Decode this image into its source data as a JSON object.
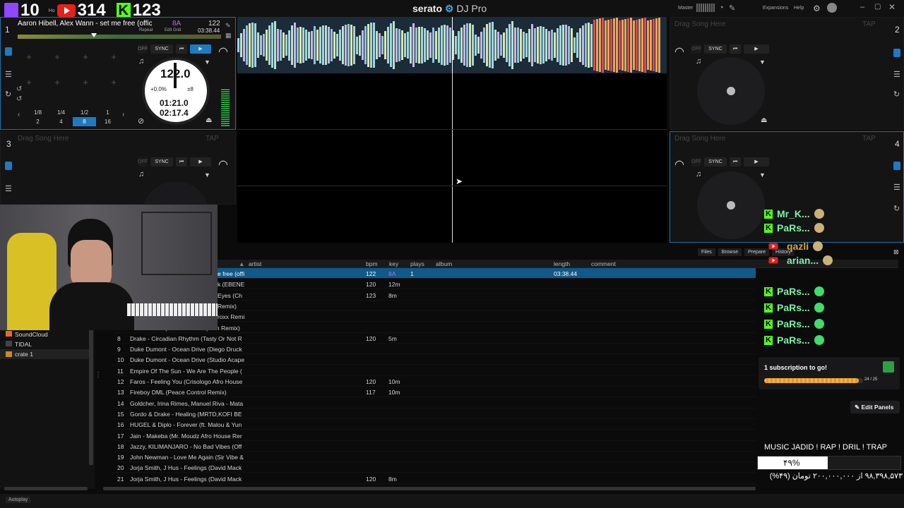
{
  "stream_counters": {
    "twitch": "10",
    "youtube": "314",
    "kick": "123",
    "home_label": "Ho"
  },
  "app": {
    "brand": "serato",
    "product": "DJ Pro",
    "master_label": "Master",
    "expansions": "Expansions",
    "help": "Help"
  },
  "deck1": {
    "number": "1",
    "title": "Aaron Hibell, Alex Wann - set me free (offic...",
    "key": "8A",
    "bpm_small": "122",
    "repeat": "Repeat",
    "edit_grid": "Edit Grid",
    "duration": "03:38.44",
    "sync": "SYNC",
    "off": "OFF",
    "platter_bpm": "122.0",
    "pitch": "+0.0%",
    "range": "±8",
    "elapsed": "01:21.0",
    "remaining": "02:17.4",
    "loops_top": [
      "1/8",
      "1/4",
      "1/2",
      "1"
    ],
    "loops_bottom": [
      "2",
      "4",
      "8",
      "16"
    ],
    "loop_selected": "8"
  },
  "deck2": {
    "number": "2",
    "drag": "Drag Song Here",
    "tap": "TAP",
    "sync": "SYNC",
    "off": "OFF"
  },
  "deck3": {
    "number": "3",
    "drag": "Drag Song Here",
    "tap": "TAP",
    "sync": "SYNC",
    "off": "OFF"
  },
  "deck4": {
    "number": "4",
    "drag": "Drag Song Here",
    "tap": "TAP",
    "sync": "SYNC",
    "off": "OFF"
  },
  "browser": {
    "tabs": [
      "Files",
      "Browse",
      "Prepare",
      "History"
    ],
    "columns": {
      "artist": "artist",
      "bpm": "bpm",
      "key": "key",
      "plays": "plays",
      "album": "album",
      "length": "length",
      "comment": "comment"
    },
    "rows": [
      {
        "n": "",
        "title": "e free (offi",
        "bpm": "122",
        "key": "8A",
        "plays": "1",
        "length": "03:38.44",
        "sel": true
      },
      {
        "n": "",
        "title": "k (EBENE",
        "bpm": "120",
        "key": "12m",
        "plays": "",
        "length": ""
      },
      {
        "n": "",
        "title": "Eyes (Ch",
        "bpm": "123",
        "key": "8m",
        "plays": "",
        "length": ""
      },
      {
        "n": "",
        "title": "Remix)",
        "bpm": "",
        "key": "",
        "plays": "",
        "length": ""
      },
      {
        "n": "",
        "title": "roxx Remi",
        "bpm": "",
        "key": "",
        "plays": "",
        "length": ""
      },
      {
        "n": "",
        "title": "Desert Rose (Afro House Rupesh Remix)",
        "bpm": "",
        "key": "",
        "plays": "",
        "length": ""
      },
      {
        "n": "8",
        "title": "Drake - Circadian Rhythm (Tasty Or Not R",
        "bpm": "120",
        "key": "5m",
        "plays": "",
        "length": ""
      },
      {
        "n": "9",
        "title": "Duke Dumont - Ocean Drive (Diego Druck",
        "bpm": "",
        "key": "",
        "plays": "",
        "length": ""
      },
      {
        "n": "10",
        "title": "Duke Dumont - Ocean Drive (Studio Acape",
        "bpm": "",
        "key": "",
        "plays": "",
        "length": ""
      },
      {
        "n": "11",
        "title": "Empire Of The Sun - We Are The People (",
        "bpm": "",
        "key": "",
        "plays": "",
        "length": ""
      },
      {
        "n": "12",
        "title": "Faros - Feeling You (Crisologo Afro House",
        "bpm": "120",
        "key": "10m",
        "plays": "",
        "length": ""
      },
      {
        "n": "13",
        "title": "Fireboy DML (Peace Control Remix)",
        "bpm": "117",
        "key": "10m",
        "plays": "",
        "length": ""
      },
      {
        "n": "14",
        "title": "Goldcher, Irina Rimes, Manuel Riva - Mata",
        "bpm": "",
        "key": "",
        "plays": "",
        "length": ""
      },
      {
        "n": "15",
        "title": "Gordo & Drake - Healing (MRTD,KOFI BE",
        "bpm": "",
        "key": "",
        "plays": "",
        "length": ""
      },
      {
        "n": "16",
        "title": "HUGEL & Diplo - Forever (ft. Malou & Yun",
        "bpm": "",
        "key": "",
        "plays": "",
        "length": ""
      },
      {
        "n": "17",
        "title": "Jain - Makeba (Mr. Moudz Afro House Rer",
        "bpm": "",
        "key": "",
        "plays": "",
        "length": ""
      },
      {
        "n": "18",
        "title": "Jazzy, KILIMANJARO - No Bad Vibes (Off",
        "bpm": "",
        "key": "",
        "plays": "",
        "length": ""
      },
      {
        "n": "19",
        "title": "John Newman - Love Me Again (Sir Vibe &",
        "bpm": "",
        "key": "",
        "plays": "",
        "length": ""
      },
      {
        "n": "20",
        "title": "Jorja Smith, J Hus - Feelings (David Mack",
        "bpm": "",
        "key": "",
        "plays": "",
        "length": ""
      },
      {
        "n": "21",
        "title": "Jorja Smith, J Hus - Feelings (David Mack",
        "bpm": "120",
        "key": "8m",
        "plays": "",
        "length": ""
      }
    ]
  },
  "sidebar": {
    "items": [
      "SoundCloud",
      "TIDAL",
      "crate 1"
    ]
  },
  "chat": {
    "users": [
      "Mr_K...",
      "PaRs...",
      "qazli",
      "arian...",
      "PaRs...",
      "PaRs...",
      "PaRs...",
      "PaRs..."
    ]
  },
  "sub_goal": {
    "text": "1 subscription to go!",
    "progress": "24 / 25",
    "fraction": 0.96
  },
  "edit_panels": "Edit Panels",
  "donate": {
    "title": "MUSIC JADID ! RAP ! DRIL ! TRAP",
    "percent": "۴۹%",
    "fraction": 0.49,
    "amount": "۹۸,۳۹۸,۵۷۳ از ۲۰۰,۰۰۰,۰۰۰ تومان (۴۹%)"
  },
  "footer": {
    "autoplay": "Autoplay"
  }
}
